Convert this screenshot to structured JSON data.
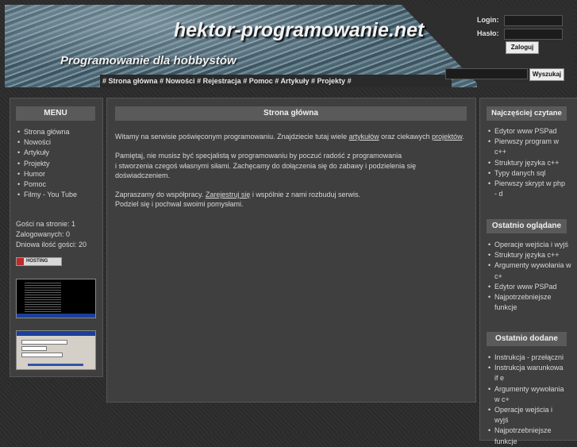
{
  "header": {
    "title": "hektor-programowanie.net",
    "slogan": "Programowanie dla hobbystów",
    "nav": [
      "Strona główna",
      "Nowości",
      "Rejestracja",
      "Pomoc",
      "Artykuły",
      "Projekty"
    ],
    "nav_separator": "#"
  },
  "login": {
    "login_label": "Login:",
    "password_label": "Hasło:",
    "submit_label": "Zaloguj",
    "login_value": "",
    "password_value": ""
  },
  "search": {
    "value": "",
    "button_label": "Wyszukaj"
  },
  "menu": {
    "title": "MENU",
    "items": [
      "Strona główna",
      "Nowości",
      "Artykuły",
      "Projekty",
      "Humor",
      "Pomoc",
      "Filmy - You Tube"
    ]
  },
  "stats": {
    "guests": "Gości na stronie: 1",
    "logged": "Zalogowanych: 0",
    "daily": "Dniowa ilość gości: 20"
  },
  "hosting_badge": "HOSTING",
  "main": {
    "title": "Strona główna",
    "p1_before": "Witamy na serwisie poświęconym programowaniu. Znajdziecie tutaj wiele ",
    "p1_link1": "artykułów",
    "p1_mid": " oraz ciekawych ",
    "p1_link2": "projektów",
    "p1_end": ".",
    "p2_line1": "Pamiętaj, nie musisz być specjalistą w programowaniu by poczuć radość z programowania",
    "p2_line2": "i stworzenia czegoś własnymi siłami. Zachęcamy do dołączenia się do zabawy i podzielenia się doświadczeniem.",
    "p3_before": "Zapraszamy do współpracy. ",
    "p3_link": "Zarejestruj się",
    "p3_after": " i wspólnie z nami rozbuduj serwis.",
    "p3_line2": "Podziel się i pochwal swoimi pomysłami."
  },
  "most_read": {
    "title": "Najczęściej czytane",
    "items": [
      "Edytor www PSPad",
      "Pierwszy program w c++",
      "Struktury języka c++",
      "Typy danych sql",
      "Pierwszy skrypt w php - d"
    ]
  },
  "recently_viewed": {
    "title": "Ostatnio oglądane",
    "items": [
      "Operacje wejścia i wyjś",
      "Struktury języka c++",
      "Argumenty wywołania w c+",
      "Edytor www PSPad",
      "Najpotrzebniejsze funkcje"
    ]
  },
  "recently_added": {
    "title": "Ostatnio dodane",
    "items": [
      "Instrukcja - przełączni",
      "Instrukcja warunkowa if e",
      "Argumenty wywołania w c+",
      "Operacje wejścia i wyjś",
      "Najpotrzebniejsze funkcje"
    ]
  }
}
